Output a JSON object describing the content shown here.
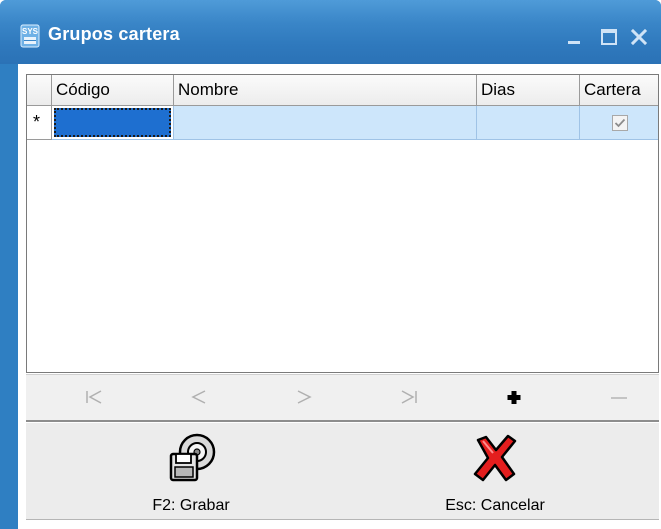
{
  "window": {
    "title": "Grupos cartera",
    "app_icon": "sys-logo-icon"
  },
  "grid": {
    "columns": [
      "Código",
      "Nombre",
      "Dias",
      "Cartera"
    ],
    "new_row_marker": "*",
    "rows": [
      {
        "codigo": "",
        "nombre": "",
        "dias": "",
        "cartera_checked": true
      }
    ]
  },
  "navigator": {
    "buttons": [
      "first-icon",
      "prior-icon",
      "next-icon",
      "last-icon",
      "insert-icon",
      "delete-icon"
    ]
  },
  "actions": {
    "save_label": "F2: Grabar",
    "cancel_label": "Esc: Cancelar"
  },
  "colors": {
    "title_bar": "#2f79bd",
    "selected_row": "#cde6fb",
    "focused_cell": "#1e6fd0"
  }
}
